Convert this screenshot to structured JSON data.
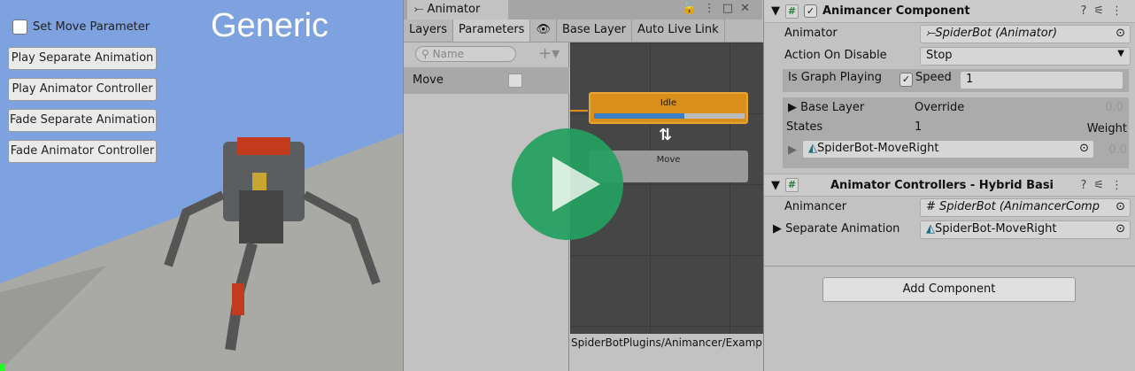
{
  "scene": {
    "title": "Generic",
    "checkbox_label": "Set Move Parameter",
    "buttons": [
      "Play Separate Animation",
      "Play Animator Controller",
      "Fade Separate Animation",
      "Fade Animator Controller"
    ]
  },
  "animator": {
    "tab": "Animator",
    "subtabs": [
      "Layers",
      "Parameters",
      "Base Layer",
      "Auto Live Link"
    ],
    "search_placeholder": "Name",
    "param": "Move",
    "states": [
      "Idle",
      "Move"
    ],
    "idle_progress": 0.6,
    "path": "SpiderBotPlugins/Animancer/Examples"
  },
  "inspector": {
    "c1": {
      "title": "Animancer Component",
      "animator_label": "Animator",
      "animator_value": "SpiderBot (Animator)",
      "aod_label": "Action On Disable",
      "aod_value": "Stop",
      "igp_label": "Is Graph Playing",
      "speed_label": "Speed",
      "speed_value": "1",
      "layer_label": "Base Layer",
      "layer_mode": "Override",
      "layer_weight": "0.0",
      "states_label": "States",
      "states_count": "1",
      "weight_label": "Weight",
      "state_name": "SpiderBot-MoveRight",
      "state_weight": "0.0"
    },
    "c2": {
      "title": "Animator Controllers - Hybrid Basi",
      "animancer_label": "Animancer",
      "animancer_value": "SpiderBot (AnimancerComp",
      "sep_label": "Separate Animation",
      "sep_value": "SpiderBot-MoveRight"
    },
    "add_component": "Add Component"
  }
}
